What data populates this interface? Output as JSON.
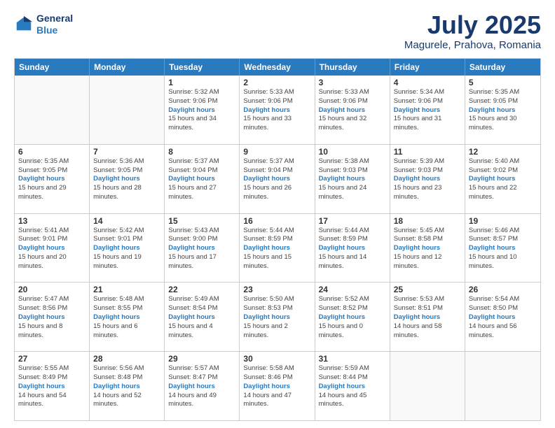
{
  "header": {
    "logo_line1": "General",
    "logo_line2": "Blue",
    "month": "July 2025",
    "location": "Magurele, Prahova, Romania"
  },
  "days_of_week": [
    "Sunday",
    "Monday",
    "Tuesday",
    "Wednesday",
    "Thursday",
    "Friday",
    "Saturday"
  ],
  "weeks": [
    [
      {
        "day": "",
        "empty": true
      },
      {
        "day": "",
        "empty": true
      },
      {
        "day": "1",
        "sunrise": "5:32 AM",
        "sunset": "9:06 PM",
        "daylight": "15 hours and 34 minutes."
      },
      {
        "day": "2",
        "sunrise": "5:33 AM",
        "sunset": "9:06 PM",
        "daylight": "15 hours and 33 minutes."
      },
      {
        "day": "3",
        "sunrise": "5:33 AM",
        "sunset": "9:06 PM",
        "daylight": "15 hours and 32 minutes."
      },
      {
        "day": "4",
        "sunrise": "5:34 AM",
        "sunset": "9:06 PM",
        "daylight": "15 hours and 31 minutes."
      },
      {
        "day": "5",
        "sunrise": "5:35 AM",
        "sunset": "9:05 PM",
        "daylight": "15 hours and 30 minutes."
      }
    ],
    [
      {
        "day": "6",
        "sunrise": "5:35 AM",
        "sunset": "9:05 PM",
        "daylight": "15 hours and 29 minutes."
      },
      {
        "day": "7",
        "sunrise": "5:36 AM",
        "sunset": "9:05 PM",
        "daylight": "15 hours and 28 minutes."
      },
      {
        "day": "8",
        "sunrise": "5:37 AM",
        "sunset": "9:04 PM",
        "daylight": "15 hours and 27 minutes."
      },
      {
        "day": "9",
        "sunrise": "5:37 AM",
        "sunset": "9:04 PM",
        "daylight": "15 hours and 26 minutes."
      },
      {
        "day": "10",
        "sunrise": "5:38 AM",
        "sunset": "9:03 PM",
        "daylight": "15 hours and 24 minutes."
      },
      {
        "day": "11",
        "sunrise": "5:39 AM",
        "sunset": "9:03 PM",
        "daylight": "15 hours and 23 minutes."
      },
      {
        "day": "12",
        "sunrise": "5:40 AM",
        "sunset": "9:02 PM",
        "daylight": "15 hours and 22 minutes."
      }
    ],
    [
      {
        "day": "13",
        "sunrise": "5:41 AM",
        "sunset": "9:01 PM",
        "daylight": "15 hours and 20 minutes."
      },
      {
        "day": "14",
        "sunrise": "5:42 AM",
        "sunset": "9:01 PM",
        "daylight": "15 hours and 19 minutes."
      },
      {
        "day": "15",
        "sunrise": "5:43 AM",
        "sunset": "9:00 PM",
        "daylight": "15 hours and 17 minutes."
      },
      {
        "day": "16",
        "sunrise": "5:44 AM",
        "sunset": "8:59 PM",
        "daylight": "15 hours and 15 minutes."
      },
      {
        "day": "17",
        "sunrise": "5:44 AM",
        "sunset": "8:59 PM",
        "daylight": "15 hours and 14 minutes."
      },
      {
        "day": "18",
        "sunrise": "5:45 AM",
        "sunset": "8:58 PM",
        "daylight": "15 hours and 12 minutes."
      },
      {
        "day": "19",
        "sunrise": "5:46 AM",
        "sunset": "8:57 PM",
        "daylight": "15 hours and 10 minutes."
      }
    ],
    [
      {
        "day": "20",
        "sunrise": "5:47 AM",
        "sunset": "8:56 PM",
        "daylight": "15 hours and 8 minutes."
      },
      {
        "day": "21",
        "sunrise": "5:48 AM",
        "sunset": "8:55 PM",
        "daylight": "15 hours and 6 minutes."
      },
      {
        "day": "22",
        "sunrise": "5:49 AM",
        "sunset": "8:54 PM",
        "daylight": "15 hours and 4 minutes."
      },
      {
        "day": "23",
        "sunrise": "5:50 AM",
        "sunset": "8:53 PM",
        "daylight": "15 hours and 2 minutes."
      },
      {
        "day": "24",
        "sunrise": "5:52 AM",
        "sunset": "8:52 PM",
        "daylight": "15 hours and 0 minutes."
      },
      {
        "day": "25",
        "sunrise": "5:53 AM",
        "sunset": "8:51 PM",
        "daylight": "14 hours and 58 minutes."
      },
      {
        "day": "26",
        "sunrise": "5:54 AM",
        "sunset": "8:50 PM",
        "daylight": "14 hours and 56 minutes."
      }
    ],
    [
      {
        "day": "27",
        "sunrise": "5:55 AM",
        "sunset": "8:49 PM",
        "daylight": "14 hours and 54 minutes."
      },
      {
        "day": "28",
        "sunrise": "5:56 AM",
        "sunset": "8:48 PM",
        "daylight": "14 hours and 52 minutes."
      },
      {
        "day": "29",
        "sunrise": "5:57 AM",
        "sunset": "8:47 PM",
        "daylight": "14 hours and 49 minutes."
      },
      {
        "day": "30",
        "sunrise": "5:58 AM",
        "sunset": "8:46 PM",
        "daylight": "14 hours and 47 minutes."
      },
      {
        "day": "31",
        "sunrise": "5:59 AM",
        "sunset": "8:44 PM",
        "daylight": "14 hours and 45 minutes."
      },
      {
        "day": "",
        "empty": true
      },
      {
        "day": "",
        "empty": true
      }
    ]
  ]
}
